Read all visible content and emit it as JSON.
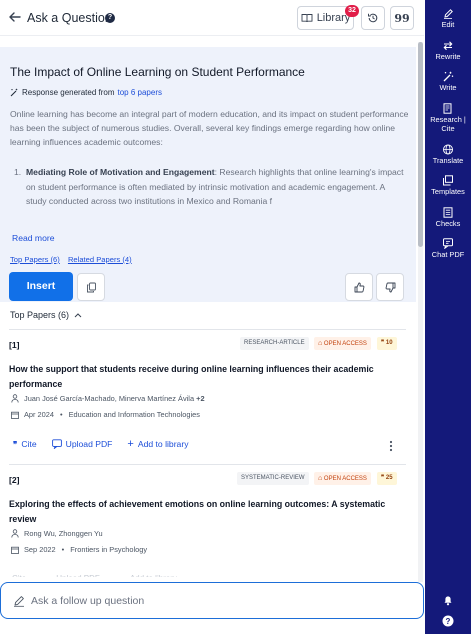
{
  "header": {
    "title": "Ask a Question",
    "library_label": "Library",
    "library_badge": "32",
    "quote_label": "99"
  },
  "answer": {
    "title": "The Impact of Online Learning on Student Performance",
    "response_prefix": "Response generated from",
    "response_link": "top 6 papers",
    "body": "Online learning has become an integral part of modern education, and its impact on student performance has been the subject of numerous studies. Overall, several key findings emerge regarding how online learning influences academic outcomes:",
    "list_item_number": "1.",
    "list_item_bold": "Mediating Role of Motivation and Engagement",
    "list_item_text": ": Research highlights that online learning's impact on student performance is often mediated by intrinsic motivation and academic engagement. A study conducted across two institutions in Mexico and Romania f",
    "read_more": "Read more",
    "link_top_papers": "Top Papers (6)",
    "link_related_papers": "Related Papers (4)",
    "insert_label": "Insert"
  },
  "top_papers": {
    "header": "Top Papers (6)",
    "items": [
      {
        "num": "[1]",
        "type_tag": "RESEARCH-ARTICLE",
        "oa_tag": "OPEN ACCESS",
        "cite_count": "10",
        "title": "How the support that students receive during online learning influences their academic performance",
        "authors": "Juan José García-Machado, Minerva Martínez Ávila",
        "authors_more": "+2",
        "date": "Apr 2024",
        "venue": "Education and Information Technologies"
      },
      {
        "num": "[2]",
        "type_tag": "SYSTEMATIC-REVIEW",
        "oa_tag": "OPEN ACCESS",
        "cite_count": "25",
        "title": "Exploring the effects of achievement emotions on online learning outcomes: A systematic review",
        "authors": "Rong Wu, Zhonggen Yu",
        "authors_more": "",
        "date": "Sep 2022",
        "venue": "Frontiers in Psychology"
      }
    ],
    "actions": {
      "cite": "Cite",
      "upload_pdf": "Upload PDF",
      "add_to_library": "Add to library"
    }
  },
  "followup": {
    "placeholder": "Ask a follow up question"
  },
  "rail": {
    "items": [
      {
        "label": "Edit",
        "icon": "pencil-icon"
      },
      {
        "label": "Rewrite",
        "icon": "rewrite-icon"
      },
      {
        "label": "Write",
        "icon": "magic-wand-icon"
      },
      {
        "label": "Research |",
        "label2": "Cite",
        "icon": "research-icon"
      },
      {
        "label": "Translate",
        "icon": "globe-icon"
      },
      {
        "label": "Templates",
        "icon": "templates-icon"
      },
      {
        "label": "Checks",
        "icon": "checks-icon"
      },
      {
        "label": "Chat PDF",
        "icon": "chat-icon"
      }
    ]
  },
  "colors": {
    "rail_bg": "#14197a",
    "accent": "#1170e8",
    "answer_bg": "#eef2fb",
    "badge": "#e11d48"
  }
}
